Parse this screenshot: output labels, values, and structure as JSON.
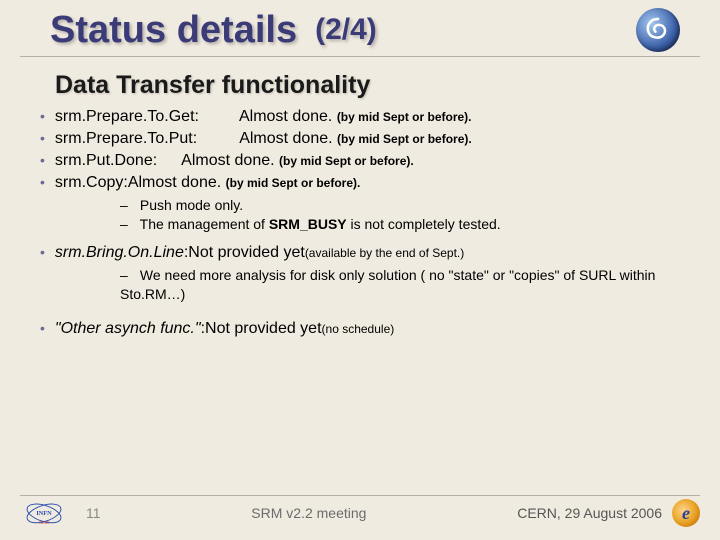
{
  "title": {
    "main": "Status details",
    "page": "(2/4)"
  },
  "subtitle": "Data Transfer functionality",
  "items": {
    "get": {
      "fn": "srm.Prepare.To.Get",
      "colon": ":",
      "status": "Almost done.",
      "note": "(by mid Sept or before)."
    },
    "put": {
      "fn": "srm.Prepare.To.Put",
      "colon": ":",
      "status": "Almost done.",
      "note": "(by mid Sept or before)."
    },
    "done": {
      "fn": "srm.Put.Done ",
      "colon": ":",
      "status": "Almost done.",
      "note": "(by mid Sept or before)."
    },
    "copy": {
      "fn": "srm.Copy ",
      "colon": ": ",
      "status": "Almost done.",
      "note": "(by mid Sept or before).",
      "sub1_a": "Push mode only.",
      "sub2_a": "The management of ",
      "sub2_b": "SRM_BUSY",
      "sub2_c": " is not completely tested."
    },
    "bol": {
      "fn": "srm.Bring.On.Line ",
      "colon": ": ",
      "status": "Not provided yet ",
      "note": "(available by the end of Sept.)",
      "sub1": "We need more analysis for disk only solution ( no \"state\" or \"copies\" of SURL within Sto.RM…)"
    },
    "other": {
      "fn": "\"Other asynch  func.\" ",
      "colon": ": ",
      "status": "Not provided yet ",
      "note": "(no schedule)"
    }
  },
  "footer": {
    "page_num": "11",
    "center": "SRM v2.2 meeting",
    "right": "CERN, 29 August 2006"
  },
  "glyph": {
    "dash": "–",
    "bullet": "•"
  }
}
